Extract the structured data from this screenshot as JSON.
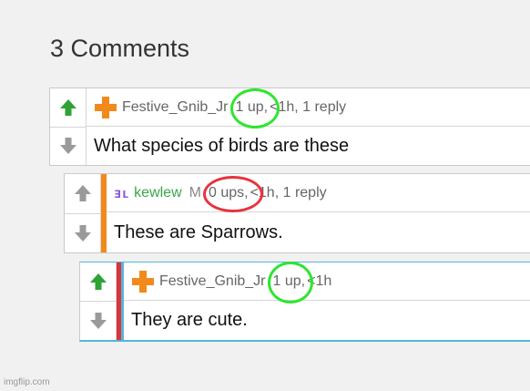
{
  "header": {
    "title": "3 Comments"
  },
  "comments": [
    {
      "username": "Festive_Gnib_Jr",
      "points": "1 up,",
      "meta_rest": "<1h, 1 reply",
      "text": "What species of birds are these",
      "points_circle_color": "#2ee62e"
    },
    {
      "flair": "ⱻʟ",
      "username": "kewlew",
      "user_flag": "M",
      "points": "0 ups,",
      "meta_rest": "<1h, 1 reply",
      "text": "These are Sparrows.",
      "points_circle_color": "#e8323e"
    },
    {
      "username": "Festive_Gnib_Jr",
      "points": "1 up,",
      "meta_rest": "<1h",
      "text": "They are cute.",
      "points_circle_color": "#2ee62e"
    }
  ],
  "icons": {
    "upvote": "upvote-arrow-icon",
    "downvote": "downvote-arrow-icon",
    "avatar": "plus-avatar-icon"
  },
  "colors": {
    "upvote_active": "#2fa236",
    "downvote": "#9a9a9a",
    "avatar_orange": "#f28a1b",
    "reply_stripe": "#f28a1b",
    "nested_stripe": "#d9353b",
    "highlight_border": "#56b5dd"
  },
  "watermark": "imgflip.com"
}
